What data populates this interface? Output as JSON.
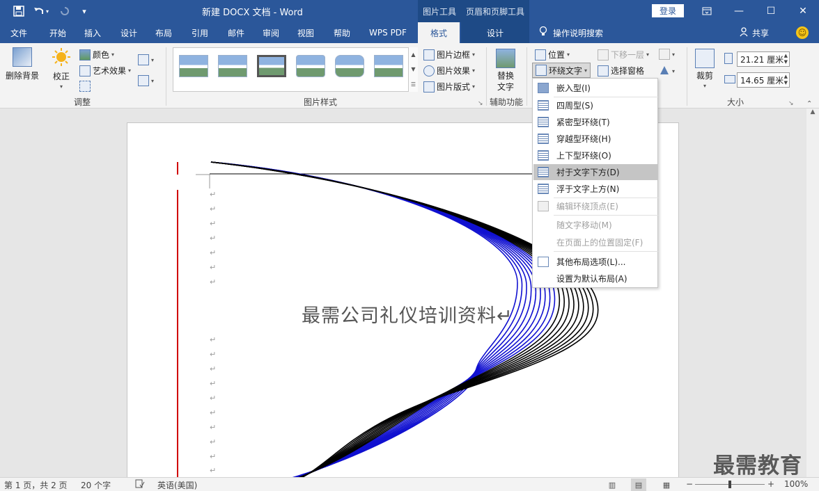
{
  "titlebar": {
    "title": "新建 DOCX 文档  -  Word",
    "save_icon": "save-icon",
    "undo_icon": "undo-icon",
    "redo_icon": "redo-icon",
    "customize_icon": "customize-quick-access-icon",
    "context_group_picture": "图片工具",
    "context_group_header": "页眉和页脚工具",
    "login": "登录",
    "ribbon_display_icon": "ribbon-display-options-icon",
    "minimize": "—",
    "maximize": "☐",
    "close": "✕"
  },
  "tabs": {
    "file": "文件",
    "home": "开始",
    "insert": "插入",
    "design": "设计",
    "layout": "布局",
    "references": "引用",
    "mailings": "邮件",
    "review": "审阅",
    "view": "视图",
    "help": "帮助",
    "wpspdf": "WPS PDF",
    "format": "格式",
    "hf_design": "设计",
    "tell_me": "操作说明搜索",
    "share": "共享",
    "lightbulb_icon": "lightbulb-icon",
    "share_icon": "person-icon",
    "smiley_icon": "smiley-icon"
  },
  "ribbon": {
    "adjust": {
      "remove_bg": "删除背景",
      "corrections": "校正",
      "color": "颜色",
      "artistic": "艺术效果",
      "label": "调整"
    },
    "picture_styles": {
      "border": "图片边框",
      "effects": "图片效果",
      "layout": "图片版式",
      "label": "图片样式"
    },
    "accessibility": {
      "alt_text_line1": "替换",
      "alt_text_line2": "文字",
      "label": "辅助功能"
    },
    "arrange": {
      "position": "位置",
      "wrap_text": "环绕文字",
      "send_backward": "下移一层",
      "selection_pane": "选择窗格"
    },
    "size": {
      "crop": "裁剪",
      "height": "21.21 厘米",
      "width": "14.65 厘米",
      "label": "大小"
    }
  },
  "wrap_menu": {
    "items": [
      {
        "label": "嵌入型(I)",
        "state": "normal"
      },
      {
        "label": "四周型(S)",
        "state": "normal"
      },
      {
        "label": "紧密型环绕(T)",
        "state": "normal"
      },
      {
        "label": "穿越型环绕(H)",
        "state": "normal"
      },
      {
        "label": "上下型环绕(O)",
        "state": "normal"
      },
      {
        "label": "衬于文字下方(D)",
        "state": "highlighted"
      },
      {
        "label": "浮于文字上方(N)",
        "state": "normal"
      },
      {
        "label": "编辑环绕顶点(E)",
        "state": "disabled"
      },
      {
        "label": "随文字移动(M)",
        "state": "disabled"
      },
      {
        "label": "在页面上的位置固定(F)",
        "state": "disabled"
      },
      {
        "label": "其他布局选项(L)...",
        "state": "normal"
      },
      {
        "label": "设置为默认布局(A)",
        "state": "normal"
      }
    ]
  },
  "document": {
    "paragraph_mark": "↵",
    "title": "最需公司礼仪培训资料↵"
  },
  "watermark": "最需教育",
  "statusbar": {
    "page": "第 1 页，共 2 页",
    "words": "20 个字",
    "proofing_icon": "proofing-icon",
    "language": "英语(美国)",
    "zoom_minus": "−",
    "zoom_plus": "+",
    "zoom": "100%"
  },
  "colors": {
    "accent": "#2b579a",
    "context_tab": "#1e4a86",
    "curve_black": "#000000",
    "curve_blue": "#1010d0",
    "margin_red": "#d00000"
  }
}
